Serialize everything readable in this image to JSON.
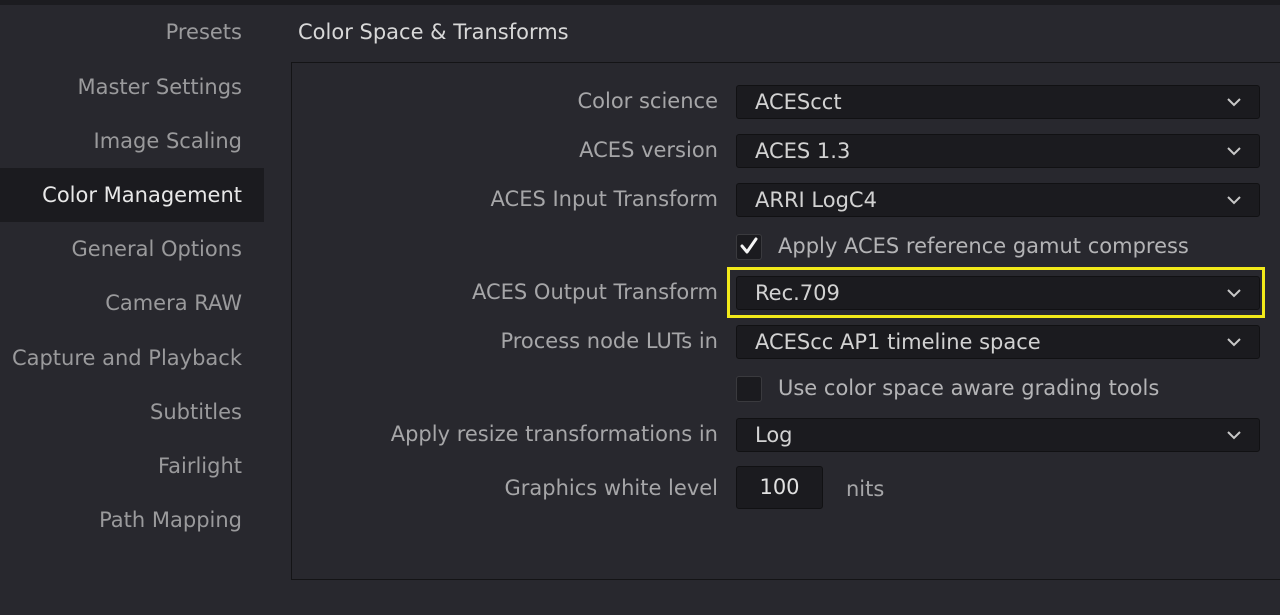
{
  "sidebar": {
    "items": [
      {
        "label": "Presets",
        "active": false
      },
      {
        "label": "Master Settings",
        "active": false
      },
      {
        "label": "Image Scaling",
        "active": false
      },
      {
        "label": "Color Management",
        "active": true
      },
      {
        "label": "General Options",
        "active": false
      },
      {
        "label": "Camera RAW",
        "active": false
      },
      {
        "label": "Capture and Playback",
        "active": false
      },
      {
        "label": "Subtitles",
        "active": false
      },
      {
        "label": "Fairlight",
        "active": false
      },
      {
        "label": "Path Mapping",
        "active": false
      }
    ]
  },
  "section": {
    "title": "Color Space & Transforms"
  },
  "fields": {
    "color_science": {
      "label": "Color science",
      "value": "ACEScct"
    },
    "aces_version": {
      "label": "ACES version",
      "value": "ACES 1.3"
    },
    "aces_input_transform": {
      "label": "ACES Input Transform",
      "value": "ARRI LogC4"
    },
    "gamut_compress": {
      "label": "Apply ACES reference gamut compress",
      "checked": true
    },
    "aces_output_transform": {
      "label": "ACES Output Transform",
      "value": "Rec.709",
      "highlighted": true
    },
    "process_node_luts": {
      "label": "Process node LUTs in",
      "value": "ACEScc AP1 timeline space"
    },
    "color_space_aware": {
      "label": "Use color space aware grading tools",
      "checked": false
    },
    "resize_transform": {
      "label": "Apply resize transformations in",
      "value": "Log"
    },
    "graphics_white_level": {
      "label": "Graphics white level",
      "value": "100",
      "unit": "nits"
    }
  },
  "icons": {
    "dropdown": "chevron-down-icon",
    "checkbox_checked": "checkmark-icon"
  },
  "colors": {
    "highlight": "#f2ea1a",
    "active_sidebar_bg": "#1b1b1f",
    "background": "#28282e"
  }
}
